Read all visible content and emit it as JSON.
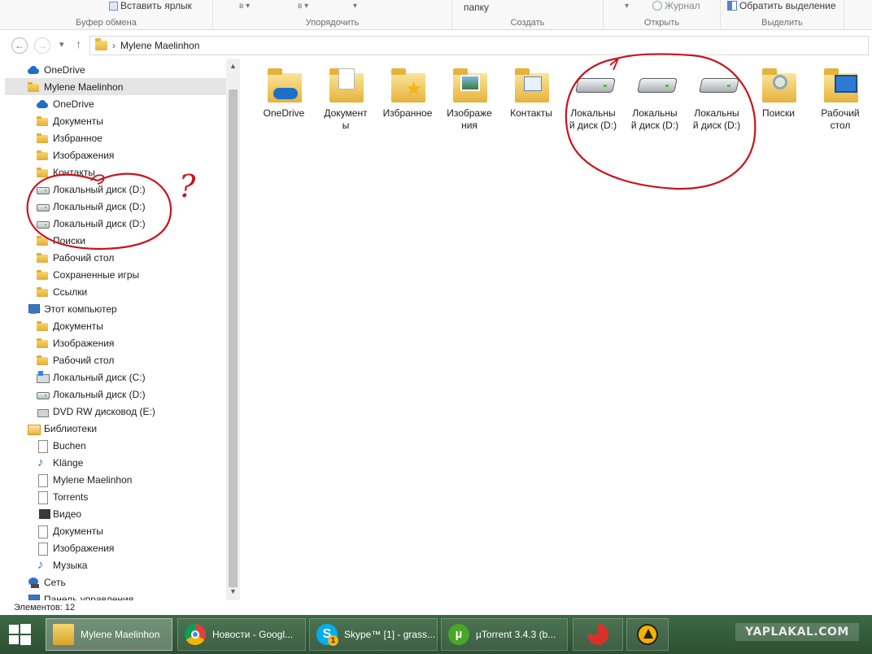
{
  "ribbon": {
    "paste_shortcut_label": "Вставить ярлык",
    "move_to_suffix": "в",
    "copy_to_suffix": "в",
    "new_folder_partial": "папку",
    "history_label": "Журнал",
    "invert_selection_label": "Обратить выделение",
    "groups": {
      "clipboard": "Буфер обмена",
      "organize": "Упорядочить",
      "create": "Создать",
      "open": "Открыть",
      "select": "Выделить"
    }
  },
  "address": {
    "separator": "›",
    "path_item": "Mylene Maelinhon"
  },
  "nav": {
    "items": [
      {
        "label": "OneDrive",
        "icon": "onedrive-icon"
      },
      {
        "label": "Mylene Maelinhon",
        "icon": "user-folder-icon"
      },
      {
        "label": "OneDrive",
        "icon": "onedrive-icon"
      },
      {
        "label": "Документы",
        "icon": "folder-icon"
      },
      {
        "label": "Избранное",
        "icon": "folder-icon"
      },
      {
        "label": "Изображения",
        "icon": "folder-icon"
      },
      {
        "label": "Контакты",
        "icon": "folder-icon"
      },
      {
        "label": "Локальный диск (D:)",
        "icon": "drive-icon"
      },
      {
        "label": "Локальный диск (D:)",
        "icon": "drive-icon"
      },
      {
        "label": "Локальный диск (D:)",
        "icon": "drive-icon"
      },
      {
        "label": "Поиски",
        "icon": "folder-icon"
      },
      {
        "label": "Рабочий стол",
        "icon": "folder-icon"
      },
      {
        "label": "Сохраненные игры",
        "icon": "folder-icon"
      },
      {
        "label": "Ссылки",
        "icon": "folder-icon"
      },
      {
        "label": "Этот компьютер",
        "icon": "computer-icon"
      },
      {
        "label": "Документы",
        "icon": "folder-icon"
      },
      {
        "label": "Изображения",
        "icon": "folder-icon"
      },
      {
        "label": "Рабочий стол",
        "icon": "folder-icon"
      },
      {
        "label": "Локальный диск (C:)",
        "icon": "windows-drive-icon"
      },
      {
        "label": "Локальный диск (D:)",
        "icon": "drive-icon"
      },
      {
        "label": "DVD RW дисковод (E:)",
        "icon": "dvd-drive-icon"
      },
      {
        "label": "Библиотеки",
        "icon": "library-icon"
      },
      {
        "label": "Buchen",
        "icon": "document-icon"
      },
      {
        "label": "Klänge",
        "icon": "music-icon"
      },
      {
        "label": "Mylene Maelinhon",
        "icon": "document-icon"
      },
      {
        "label": "Torrents",
        "icon": "document-icon"
      },
      {
        "label": "Видео",
        "icon": "video-icon"
      },
      {
        "label": "Документы",
        "icon": "document-icon"
      },
      {
        "label": "Изображения",
        "icon": "document-icon"
      },
      {
        "label": "Музыка",
        "icon": "music-icon"
      },
      {
        "label": "Сеть",
        "icon": "network-icon"
      },
      {
        "label": "Панель управления",
        "icon": "control-panel-icon"
      }
    ]
  },
  "content": {
    "tiles": [
      {
        "line1": "OneDrive",
        "line2": "",
        "icon": "onedrive-folder-icon"
      },
      {
        "line1": "Документ",
        "line2": "ы",
        "icon": "documents-folder-icon"
      },
      {
        "line1": "Избранное",
        "line2": "",
        "icon": "favorites-folder-icon"
      },
      {
        "line1": "Изображе",
        "line2": "ния",
        "icon": "pictures-folder-icon"
      },
      {
        "line1": "Контакты",
        "line2": "",
        "icon": "contacts-folder-icon"
      },
      {
        "line1": "Локальны",
        "line2": "й диск (D:)",
        "icon": "drive-icon"
      },
      {
        "line1": "Локальны",
        "line2": "й диск (D:)",
        "icon": "drive-icon"
      },
      {
        "line1": "Локальны",
        "line2": "й диск (D:)",
        "icon": "drive-icon"
      },
      {
        "line1": "Поиски",
        "line2": "",
        "icon": "searches-folder-icon"
      },
      {
        "line1": "Рабочий",
        "line2": "стол",
        "icon": "desktop-folder-icon"
      }
    ]
  },
  "status": {
    "items_count": "Элементов: 12"
  },
  "taskbar": {
    "buttons": [
      {
        "label": "Mylene Maelinhon",
        "icon": "explorer-icon",
        "active": true
      },
      {
        "label": "Новости - Googl...",
        "icon": "chrome-icon"
      },
      {
        "label": "Skype™ [1] - grass...",
        "icon": "skype-icon"
      },
      {
        "label": "µTorrent 3.4.3  (b...",
        "icon": "utorrent-icon"
      },
      {
        "label": "",
        "icon": "ccleaner-icon"
      },
      {
        "label": "",
        "icon": "aimp-icon"
      }
    ],
    "skype_badge": "1",
    "watermark": "YAPLAKAL.COM"
  },
  "annotation": {
    "question_mark": "?",
    "color": "#c8141e"
  }
}
